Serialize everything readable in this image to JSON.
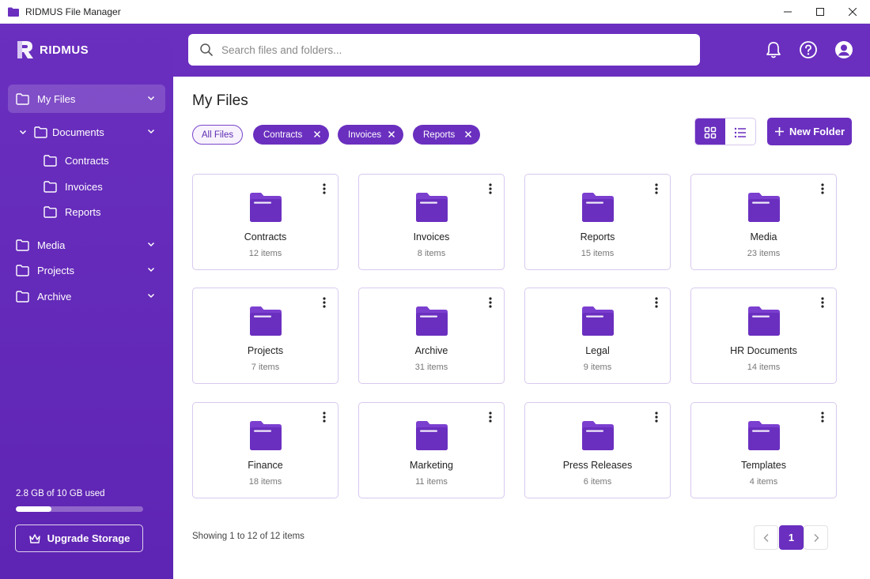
{
  "window": {
    "title": "RIDMUS File Manager"
  },
  "sidebar": {
    "brand": "RIDMUS",
    "items": [
      {
        "label": "My Files"
      },
      {
        "label": "Documents"
      },
      {
        "label": "Contracts"
      },
      {
        "label": "Invoices"
      },
      {
        "label": "Reports"
      },
      {
        "label": "Media"
      },
      {
        "label": "Projects"
      },
      {
        "label": "Archive"
      }
    ],
    "storage": {
      "text": "2.8 GB of 10 GB used",
      "used_fraction": 0.28
    },
    "upgrade_label": "Upgrade Storage"
  },
  "search": {
    "placeholder": "Search files and folders..."
  },
  "main": {
    "title": "My Files",
    "filters": {
      "all": "All Files",
      "chips": [
        "Contracts",
        "Invoices",
        "Reports"
      ]
    },
    "new_folder_label": "New Folder",
    "folders": [
      {
        "name": "Contracts",
        "count": "12 items"
      },
      {
        "name": "Invoices",
        "count": "8 items"
      },
      {
        "name": "Reports",
        "count": "15 items"
      },
      {
        "name": "Media",
        "count": "23 items"
      },
      {
        "name": "Projects",
        "count": "7 items"
      },
      {
        "name": "Archive",
        "count": "31 items"
      },
      {
        "name": "Legal",
        "count": "9 items"
      },
      {
        "name": "HR Documents",
        "count": "14 items"
      },
      {
        "name": "Finance",
        "count": "18 items"
      },
      {
        "name": "Marketing",
        "count": "11 items"
      },
      {
        "name": "Press Releases",
        "count": "6 items"
      },
      {
        "name": "Templates",
        "count": "4 items"
      }
    ],
    "showing": "Showing 1 to 12 of 12 items",
    "pagination": {
      "current": "1"
    }
  },
  "colors": {
    "accent": "#6a2fbf",
    "folder": "#7b3fd0"
  },
  "icons": [
    "app-folder-icon",
    "minimize-icon",
    "maximize-icon",
    "close-icon",
    "folder-icon",
    "chevron-down-icon",
    "search-icon",
    "bell-icon",
    "help-icon",
    "user-icon",
    "grid-view-icon",
    "list-view-icon",
    "plus-icon",
    "more-vertical-icon",
    "crown-icon",
    "chevron-left-icon",
    "chevron-right-icon"
  ]
}
